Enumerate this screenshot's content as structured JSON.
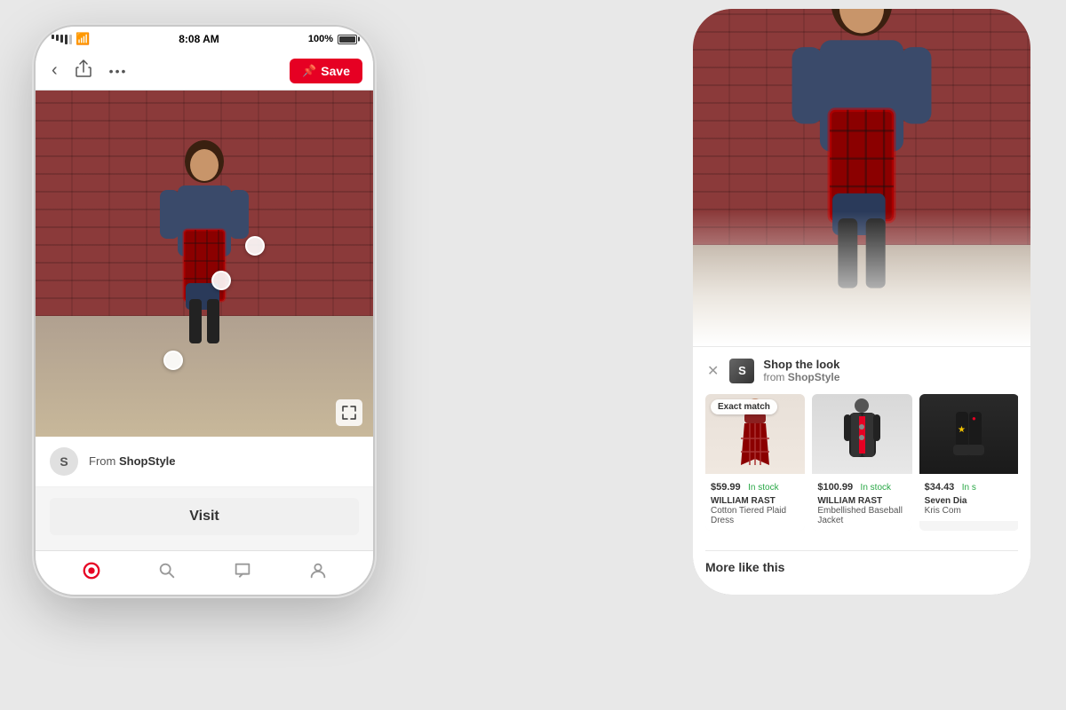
{
  "background": "#e8e8e8",
  "phone_left": {
    "status_bar": {
      "time": "8:08 AM",
      "battery": "100%"
    },
    "nav": {
      "save_label": "Save"
    },
    "source": {
      "avatar_letter": "S",
      "from_text": "From ",
      "source_name": "ShopStyle"
    },
    "visit_button": "Visit",
    "bottom_nav": {
      "icons": [
        "home",
        "search",
        "chat",
        "profile"
      ]
    }
  },
  "phone_right": {
    "shop_panel": {
      "title": "Shop the look",
      "from_text": "from ",
      "source_name": "ShopStyle",
      "avatar_letter": "S"
    },
    "products": [
      {
        "price": "$59.99",
        "in_stock": "In stock",
        "brand": "WILLIAM RAST",
        "name": "Cotton Tiered Plaid Dress",
        "has_exact_match": true
      },
      {
        "price": "$100.99",
        "in_stock": "In stock",
        "brand": "WILLIAM RAST",
        "name": "Embellished Baseball Jacket",
        "has_exact_match": false
      },
      {
        "price": "$34.43",
        "in_stock": "In s",
        "brand": "Seven Dia",
        "name": "Kris Com",
        "has_exact_match": false
      }
    ],
    "exact_match_label": "Exact match",
    "more_section_title": "More like this"
  }
}
